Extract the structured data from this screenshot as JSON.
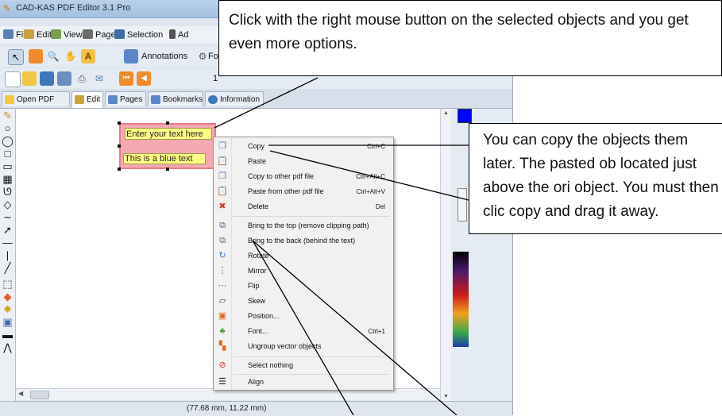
{
  "window": {
    "title": "CAD-KAS PDF Editor 3.1 Pro"
  },
  "menu": [
    {
      "label": "File",
      "icon": "file-icon",
      "color": "#5a7fb0"
    },
    {
      "label": "Edit",
      "icon": "edit-icon",
      "color": "#c9a23c"
    },
    {
      "label": "View",
      "icon": "view-icon",
      "color": "#7a9e4d"
    },
    {
      "label": "Page",
      "icon": "page-icon",
      "color": "#6b6b6b"
    },
    {
      "label": "Selection",
      "icon": "selection-icon",
      "color": "#3b6ea5"
    },
    {
      "label": "Ad",
      "icon": "advanced-icon",
      "color": "#555555"
    }
  ],
  "toolbar2": {
    "annotations": "Annotations",
    "forms": "Forms"
  },
  "toolbar3": {
    "page_field": "1"
  },
  "tabs": [
    {
      "label": "Open PDF file",
      "icon": "open-pdf-icon"
    },
    {
      "label": "Edit",
      "icon": "edit-tab-icon"
    },
    {
      "label": "Pages",
      "icon": "pages-icon"
    },
    {
      "label": "Bookmarks",
      "icon": "bookmarks-icon"
    },
    {
      "label": "Information",
      "icon": "information-icon"
    }
  ],
  "canvas": {
    "text1": "Enter your text here",
    "text2": "This is a blue text"
  },
  "context_menu": [
    {
      "label": "Copy",
      "shortcut": "Ctrl+C",
      "icon": "copy-icon"
    },
    {
      "label": "Paste",
      "shortcut": "",
      "icon": "paste-icon"
    },
    {
      "label": "Copy to other pdf file",
      "shortcut": "Ctrl+Alt+C",
      "icon": "copy-other-icon"
    },
    {
      "label": "Paste from other pdf file",
      "shortcut": "Ctrl+Alt+V",
      "icon": "paste-other-icon"
    },
    {
      "label": "Delete",
      "shortcut": "Del",
      "icon": "delete-icon"
    },
    {
      "label": "Bring to the top (remove clipping path)",
      "shortcut": "",
      "icon": "bring-top-icon"
    },
    {
      "label": "Bring to the back (behind the text)",
      "shortcut": "",
      "icon": "bring-back-icon"
    },
    {
      "label": "Rotate",
      "shortcut": "",
      "icon": "rotate-icon"
    },
    {
      "label": "Mirror",
      "shortcut": "",
      "icon": "mirror-icon"
    },
    {
      "label": "Flip",
      "shortcut": "",
      "icon": "flip-icon"
    },
    {
      "label": "Skew",
      "shortcut": "",
      "icon": "skew-icon"
    },
    {
      "label": "Position...",
      "shortcut": "",
      "icon": "position-icon"
    },
    {
      "label": "Font...",
      "shortcut": "Ctrl+1",
      "icon": "font-icon"
    },
    {
      "label": "Ungroup vector objects",
      "shortcut": "",
      "icon": "ungroup-icon"
    },
    {
      "label": "Select nothing",
      "shortcut": "",
      "icon": "select-nothing-icon"
    },
    {
      "label": "Align",
      "shortcut": "",
      "icon": "align-icon"
    }
  ],
  "status": {
    "coords": "(77.68 mm, 11.22 mm)"
  },
  "callouts": {
    "top": "Click with the right mouse button on the selected objects and you get even more options.",
    "right": "You can copy the objects them later. The pasted ob located just above the ori object. You must then clic copy and drag it away."
  },
  "colors": {
    "selection_fill": "#f3a9b1",
    "selection_border": "#e87b86",
    "text_highlight": "#ffff88"
  }
}
